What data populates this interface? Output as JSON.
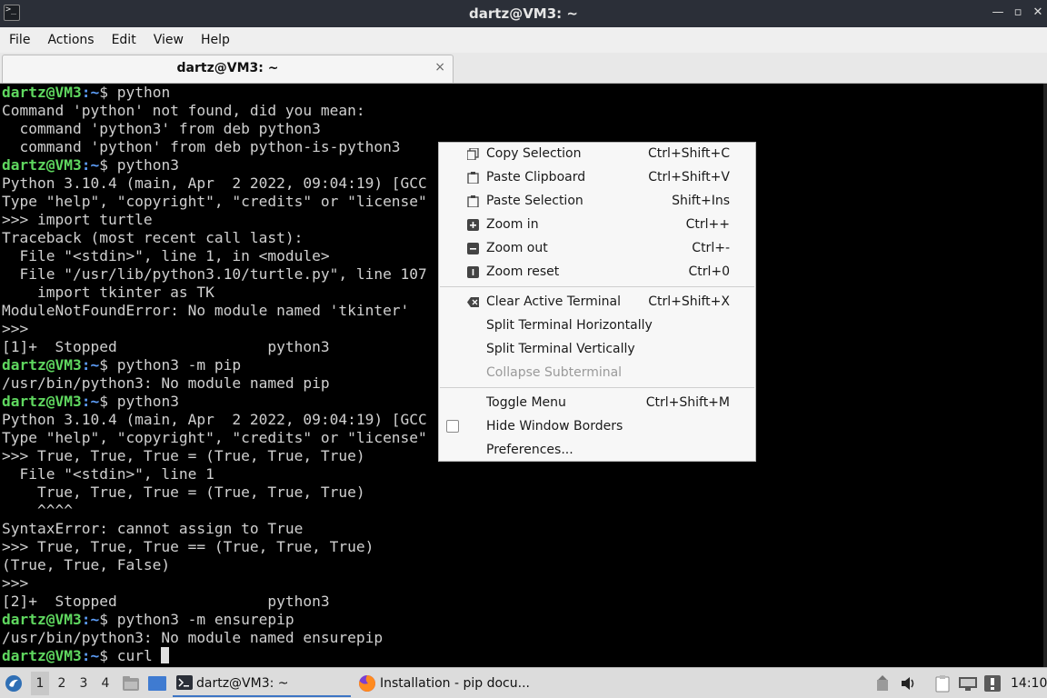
{
  "window": {
    "title": "dartz@VM3: ~"
  },
  "menubar": [
    "File",
    "Actions",
    "Edit",
    "View",
    "Help"
  ],
  "tab": {
    "label": "dartz@VM3: ~",
    "close": "×"
  },
  "terminal": {
    "user": "dartz@VM3",
    "path": "~",
    "lines": [
      {
        "prompt": true,
        "cmd": " python"
      },
      {
        "text": "Command 'python' not found, did you mean:"
      },
      {
        "text": "  command 'python3' from deb python3"
      },
      {
        "text": "  command 'python' from deb python-is-python3"
      },
      {
        "prompt": true,
        "cmd": " python3"
      },
      {
        "text": "Python 3.10.4 (main, Apr  2 2022, 09:04:19) [GCC"
      },
      {
        "text": "Type \"help\", \"copyright\", \"credits\" or \"license\""
      },
      {
        "text": ">>> import turtle"
      },
      {
        "text": "Traceback (most recent call last):"
      },
      {
        "text": "  File \"<stdin>\", line 1, in <module>"
      },
      {
        "text": "  File \"/usr/lib/python3.10/turtle.py\", line 107"
      },
      {
        "text": "    import tkinter as TK"
      },
      {
        "text": "ModuleNotFoundError: No module named 'tkinter'"
      },
      {
        "text": ">>>"
      },
      {
        "text": "[1]+  Stopped                 python3"
      },
      {
        "prompt": true,
        "cmd": " python3 -m pip"
      },
      {
        "text": "/usr/bin/python3: No module named pip"
      },
      {
        "prompt": true,
        "cmd": " python3"
      },
      {
        "text": "Python 3.10.4 (main, Apr  2 2022, 09:04:19) [GCC"
      },
      {
        "text": "Type \"help\", \"copyright\", \"credits\" or \"license\""
      },
      {
        "text": ">>> True, True, True = (True, True, True)"
      },
      {
        "text": "  File \"<stdin>\", line 1"
      },
      {
        "text": "    True, True, True = (True, True, True)"
      },
      {
        "text": "    ^^^^"
      },
      {
        "text": "SyntaxError: cannot assign to True"
      },
      {
        "text": ">>> True, True, True == (True, True, True)"
      },
      {
        "text": "(True, True, False)"
      },
      {
        "text": ">>>"
      },
      {
        "text": "[2]+  Stopped                 python3"
      },
      {
        "prompt": true,
        "cmd": " python3 -m ensurepip"
      },
      {
        "text": "/usr/bin/python3: No module named ensurepip"
      },
      {
        "prompt": true,
        "cmd": " curl ",
        "cursor": true
      }
    ]
  },
  "context_menu": {
    "items": [
      {
        "label": "Copy Selection",
        "shortcut": "Ctrl+Shift+C",
        "icon": "copy-icon"
      },
      {
        "label": "Paste Clipboard",
        "shortcut": "Ctrl+Shift+V",
        "icon": "paste-icon"
      },
      {
        "label": "Paste Selection",
        "shortcut": "Shift+Ins",
        "icon": "paste-icon"
      },
      {
        "label": "Zoom in",
        "shortcut": "Ctrl++",
        "icon": "zoom-in-icon"
      },
      {
        "label": "Zoom out",
        "shortcut": "Ctrl+-",
        "icon": "zoom-out-icon"
      },
      {
        "label": "Zoom reset",
        "shortcut": "Ctrl+0",
        "icon": "zoom-reset-icon"
      },
      {
        "label": "Clear Active Terminal",
        "shortcut": "Ctrl+Shift+X",
        "icon": "clear-icon"
      },
      {
        "label": "Split Terminal Horizontally",
        "shortcut": ""
      },
      {
        "label": "Split Terminal Vertically",
        "shortcut": ""
      },
      {
        "label": "Collapse Subterminal",
        "shortcut": "",
        "disabled": true
      },
      {
        "label": "Toggle Menu",
        "shortcut": "Ctrl+Shift+M"
      },
      {
        "label": "Hide Window Borders",
        "shortcut": "",
        "checkbox": true,
        "checked": false
      },
      {
        "label": "Preferences...",
        "shortcut": ""
      }
    ]
  },
  "taskbar": {
    "workspaces": [
      "1",
      "2",
      "3",
      "4"
    ],
    "active_workspace": "1",
    "tasks": [
      {
        "label": "dartz@VM3: ~",
        "icon": "terminal-icon"
      },
      {
        "label": "Installation - pip docu...",
        "icon": "firefox-icon"
      }
    ],
    "clock": "14:10"
  },
  "colors": {
    "prompt_user": "#5fd75f",
    "prompt_path": "#5c9cf5",
    "terminal_bg": "#000000",
    "terminal_fg": "#d0d0d0"
  }
}
